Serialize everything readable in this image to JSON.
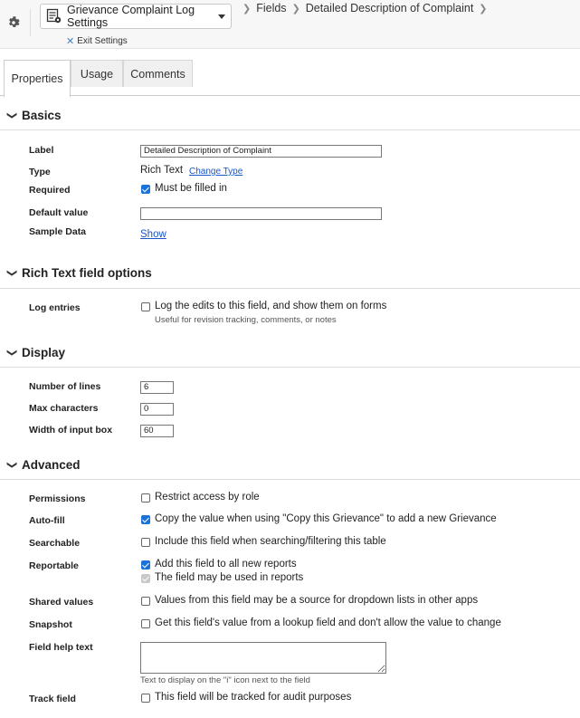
{
  "header": {
    "app_name": "Grievance Complaint Log Settings",
    "breadcrumbs": [
      "Fields",
      "Detailed Description of Complaint"
    ],
    "exit_label": "Exit Settings"
  },
  "tabs": [
    {
      "label": "Properties",
      "active": true
    },
    {
      "label": "Usage",
      "active": false
    },
    {
      "label": "Comments",
      "active": false
    }
  ],
  "basics": {
    "title": "Basics",
    "label_label": "Label",
    "label_value": "Detailed Description of Complaint",
    "type_label": "Type",
    "type_value": "Rich Text",
    "change_type": "Change Type",
    "required_label": "Required",
    "required_text": "Must be filled in",
    "required_checked": true,
    "default_label": "Default value",
    "default_value": "",
    "sample_label": "Sample Data",
    "sample_link": "Show"
  },
  "richtext": {
    "title": "Rich Text field options",
    "log_label": "Log entries",
    "log_text": "Log the edits to this field, and show them on forms",
    "log_hint": "Useful for revision tracking, comments, or notes",
    "log_checked": false
  },
  "display": {
    "title": "Display",
    "lines_label": "Number of lines",
    "lines_value": "6",
    "maxchars_label": "Max characters",
    "maxchars_value": "0",
    "width_label": "Width of input box",
    "width_value": "60"
  },
  "advanced": {
    "title": "Advanced",
    "permissions_label": "Permissions",
    "permissions_text": "Restrict access by role",
    "permissions_checked": false,
    "autofill_label": "Auto-fill",
    "autofill_text": "Copy the value when using \"Copy this Grievance\" to add a new Grievance",
    "autofill_checked": true,
    "searchable_label": "Searchable",
    "searchable_text": "Include this field when searching/filtering this table",
    "searchable_checked": false,
    "reportable_label": "Reportable",
    "reportable_text": "Add this field to all new reports",
    "reportable_checked": true,
    "reportable_text2": "The field may be used in reports",
    "reportable2_checked": true,
    "shared_label": "Shared values",
    "shared_text": "Values from this field may be a source for dropdown lists in other apps",
    "shared_checked": false,
    "snapshot_label": "Snapshot",
    "snapshot_text": "Get this field's value from a lookup field and don't allow the value to change",
    "snapshot_checked": false,
    "help_label": "Field help text",
    "help_value": "",
    "help_hint": "Text to display on the \"i\" icon next to the field",
    "track_label": "Track field",
    "track_text": "This field will be tracked for audit purposes",
    "track_checked": false
  },
  "colors": {
    "accent": "#1a73d9",
    "link": "#1a55c8",
    "exit_icon": "#4a7fc1"
  },
  "icons": {
    "settings": "gear-icon",
    "app": "table-settings-icon",
    "exit": "close-icon",
    "section_toggle": "chevron-down-icon"
  }
}
